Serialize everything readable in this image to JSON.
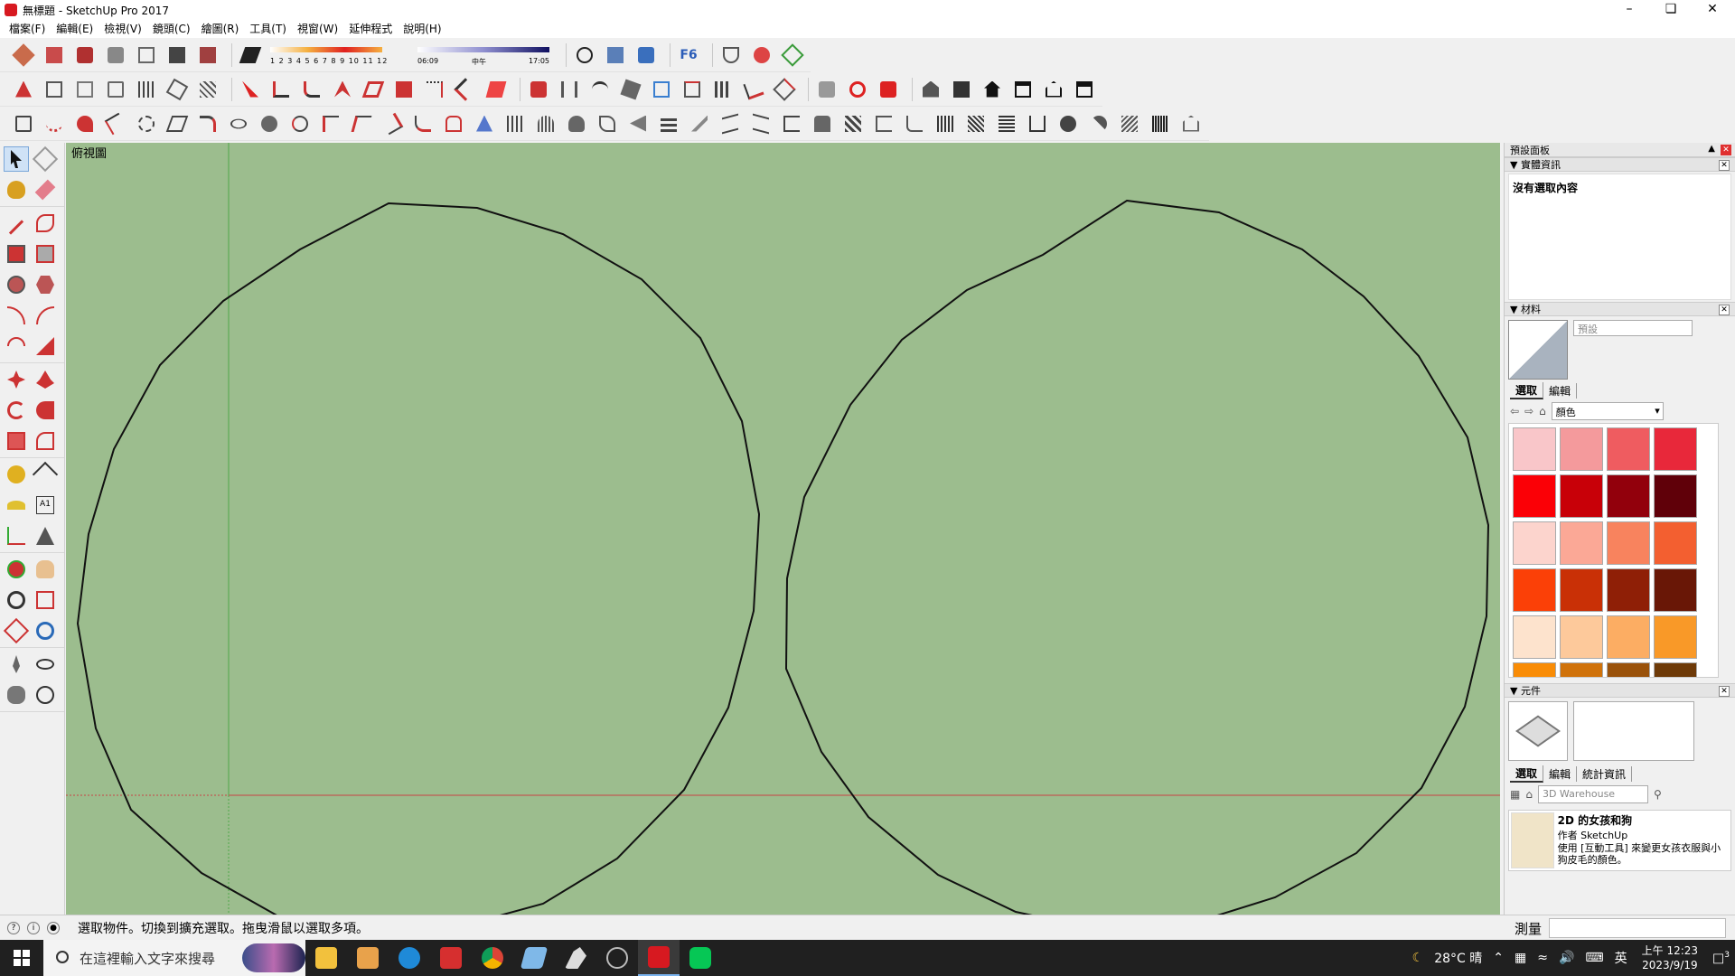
{
  "window": {
    "title": "無標題 - SketchUp Pro 2017",
    "controls": [
      "minimize-icon",
      "maximize-icon",
      "close-icon"
    ]
  },
  "menu": [
    "檔案(F)",
    "編輯(E)",
    "檢視(V)",
    "鏡頭(C)",
    "繪圖(R)",
    "工具(T)",
    "視窗(W)",
    "延伸程式",
    "說明(H)"
  ],
  "toolbar": {
    "shadow_scale": "1 2 3 4 5 6 7 8 9 10 11 12",
    "time_start": "06:09",
    "time_mid": "中午",
    "time_end": "17:05"
  },
  "viewport": {
    "scene_label": "俯視圖",
    "background_color": "#9cbd8e"
  },
  "tray": {
    "title": "預設面板",
    "entity_info": {
      "header": "實體資訊",
      "content": "沒有選取內容"
    },
    "materials": {
      "header": "材料",
      "name_value": "預設",
      "tab_select": "選取",
      "tab_edit": "編輯",
      "collection": "顏色",
      "swatches": [
        "#f9c6c9",
        "#f49a9c",
        "#ef5c60",
        "#e8283a",
        "#fb0006",
        "#c80008",
        "#92000c",
        "#600009",
        "#fcd4cd",
        "#fba896",
        "#f8835e",
        "#f35f30",
        "#fb4007",
        "#c93006",
        "#8f1f06",
        "#691706",
        "#fde3cd",
        "#fdc99b",
        "#fcad63",
        "#f99928",
        "#f98c06",
        "#d0720a",
        "#9a520a",
        "#6e3a08"
      ]
    },
    "components": {
      "header": "元件",
      "tab_select": "選取",
      "tab_edit": "編輯",
      "tab_stats": "統計資訊",
      "search_placeholder": "3D Warehouse",
      "item_title": "2D 的女孩和狗",
      "item_author": "作者 SketchUp",
      "item_desc": "使用 [互動工具] 來變更女孩衣服與小狗皮毛的顏色。"
    }
  },
  "status": {
    "hint": "選取物件。切換到擴充選取。拖曳滑鼠以選取多項。",
    "measure_label": "測量",
    "measure_value": ""
  },
  "taskbar": {
    "search_placeholder": "在這裡輸入文字來搜尋",
    "weather": "28°C 晴",
    "ime": "英",
    "time": "上午 12:23",
    "date": "2023/9/19",
    "notifications": "3"
  }
}
